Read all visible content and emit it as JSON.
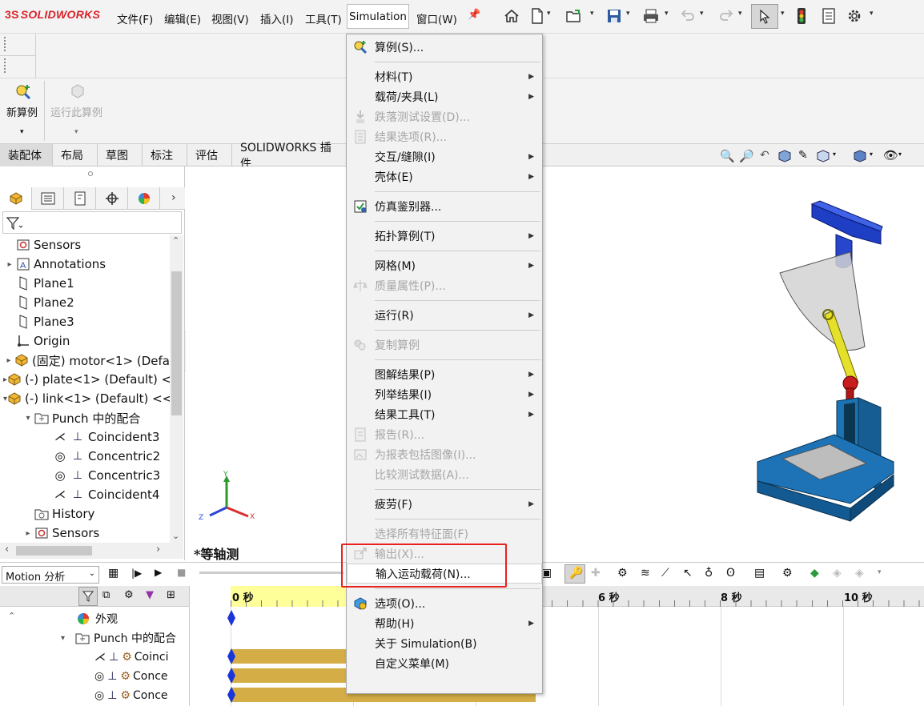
{
  "app": {
    "logo": "SOLIDWORKS",
    "logo_mark": "3S"
  },
  "menubar": {
    "items": [
      "文件(F)",
      "编辑(E)",
      "视图(V)",
      "插入(I)",
      "工具(T)",
      "Simulation",
      "窗口(W)"
    ]
  },
  "command_manager": {
    "new_study": "新算例",
    "run_study": "运行此算例"
  },
  "tabs": [
    "装配体",
    "布局",
    "草图",
    "标注",
    "评估",
    "SOLIDWORKS 插件"
  ],
  "feature_tree": [
    {
      "label": "Sensors",
      "icon": "sensor-icon",
      "indent": 0,
      "exp": ""
    },
    {
      "label": "Annotations",
      "icon": "annotation-icon",
      "indent": 0,
      "exp": "▸"
    },
    {
      "label": "Plane1",
      "icon": "plane-icon",
      "indent": 0,
      "exp": ""
    },
    {
      "label": "Plane2",
      "icon": "plane-icon",
      "indent": 0,
      "exp": ""
    },
    {
      "label": "Plane3",
      "icon": "plane-icon",
      "indent": 0,
      "exp": ""
    },
    {
      "label": "Origin",
      "icon": "origin-icon",
      "indent": 0,
      "exp": ""
    },
    {
      "label": "(固定) motor<1> (Defa",
      "icon": "part-icon",
      "indent": 0,
      "exp": "▸"
    },
    {
      "label": "(-) plate<1> (Default) <",
      "icon": "part-icon",
      "indent": 0,
      "exp": "▸"
    },
    {
      "label": "(-) link<1> (Default) <<",
      "icon": "part-icon",
      "indent": 0,
      "exp": "▾"
    },
    {
      "label": "Punch 中的配合",
      "icon": "mates-folder-icon",
      "indent": 1,
      "exp": "▾"
    },
    {
      "label": "Coincident3",
      "icon": "coincident-icon",
      "indent": 2,
      "exp": ""
    },
    {
      "label": "Concentric2",
      "icon": "concentric-icon",
      "indent": 2,
      "exp": ""
    },
    {
      "label": "Concentric3",
      "icon": "concentric-icon",
      "indent": 2,
      "exp": ""
    },
    {
      "label": "Coincident4",
      "icon": "coincident-icon",
      "indent": 2,
      "exp": ""
    },
    {
      "label": "History",
      "icon": "history-icon",
      "indent": 1,
      "exp": ""
    },
    {
      "label": "Sensors",
      "icon": "sensor-icon",
      "indent": 1,
      "exp": "▸"
    }
  ],
  "viewport": {
    "view_label": "*等轴测",
    "axis_x": "X",
    "axis_y": "Y",
    "axis_z": "Z"
  },
  "motion": {
    "study_type": "Motion 分析",
    "time_labels": [
      "0 秒",
      "6 秒",
      "8 秒",
      "10 秒"
    ],
    "tree": [
      {
        "label": "外观",
        "indent": 1
      },
      {
        "label": "Punch 中的配合",
        "indent": 1
      },
      {
        "label": "Coinci",
        "indent": 2
      },
      {
        "label": "Conce",
        "indent": 2
      },
      {
        "label": "Conce",
        "indent": 2
      }
    ]
  },
  "simulation_menu": [
    {
      "label": "算例(S)...",
      "icon": "study-icon",
      "arrow": false,
      "disabled": false
    },
    {
      "label": "材料(T)",
      "icon": "",
      "arrow": true,
      "disabled": false
    },
    {
      "label": "载荷/夹具(L)",
      "icon": "",
      "arrow": true,
      "disabled": false
    },
    {
      "label": "跌落测试设置(D)...",
      "icon": "drop-test-icon",
      "arrow": false,
      "disabled": true
    },
    {
      "label": "结果选项(R)...",
      "icon": "result-options-icon",
      "arrow": false,
      "disabled": true
    },
    {
      "label": "交互/缝隙(I)",
      "icon": "",
      "arrow": true,
      "disabled": false
    },
    {
      "label": "壳体(E)",
      "icon": "",
      "arrow": true,
      "disabled": false
    },
    {
      "label": "仿真鉴别器...",
      "icon": "sim-evaluator-icon",
      "arrow": false,
      "disabled": false
    },
    {
      "label": "拓扑算例(T)",
      "icon": "",
      "arrow": true,
      "disabled": false
    },
    {
      "label": "网格(M)",
      "icon": "",
      "arrow": true,
      "disabled": false
    },
    {
      "label": "质量属性(P)...",
      "icon": "mass-props-icon",
      "arrow": false,
      "disabled": true
    },
    {
      "label": "运行(R)",
      "icon": "",
      "arrow": true,
      "disabled": false
    },
    {
      "label": "复制算例",
      "icon": "copy-study-icon",
      "arrow": false,
      "disabled": true
    },
    {
      "label": "图解结果(P)",
      "icon": "",
      "arrow": true,
      "disabled": false
    },
    {
      "label": "列举结果(I)",
      "icon": "",
      "arrow": true,
      "disabled": false
    },
    {
      "label": "结果工具(T)",
      "icon": "",
      "arrow": true,
      "disabled": false
    },
    {
      "label": "报告(R)...",
      "icon": "report-icon",
      "arrow": false,
      "disabled": true
    },
    {
      "label": "为报表包括图像(I)...",
      "icon": "include-image-icon",
      "arrow": false,
      "disabled": true
    },
    {
      "label": "比较测试数据(A)...",
      "icon": "",
      "arrow": false,
      "disabled": true
    },
    {
      "label": "疲劳(F)",
      "icon": "",
      "arrow": true,
      "disabled": false
    },
    {
      "label": "选择所有特征面(F)",
      "icon": "",
      "arrow": false,
      "disabled": true
    },
    {
      "label": "输出(X)...",
      "icon": "export-icon",
      "arrow": false,
      "disabled": true
    },
    {
      "label": "输入运动载荷(N)...",
      "icon": "",
      "arrow": false,
      "disabled": false
    },
    {
      "label": "选项(O)...",
      "icon": "options-icon",
      "arrow": false,
      "disabled": false
    },
    {
      "label": "帮助(H)",
      "icon": "",
      "arrow": true,
      "disabled": false
    },
    {
      "label": "关于 Simulation(B)",
      "icon": "",
      "arrow": false,
      "disabled": false
    },
    {
      "label": "自定义菜单(M)",
      "icon": "",
      "arrow": false,
      "disabled": false
    }
  ],
  "colors": {
    "brand_red": "#d8232a",
    "highlight_box": "#e8221c",
    "timeline_key": "#d4ad46",
    "key_marker": "#1a35d8"
  }
}
